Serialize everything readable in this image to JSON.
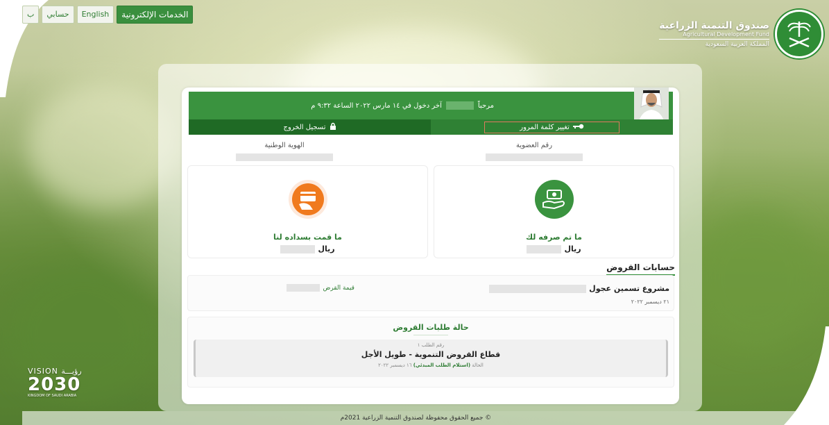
{
  "topnav": {
    "eservices": "الخدمات الإلكترونية",
    "english": "English",
    "account": "حسابي",
    "extra": "ب"
  },
  "logo": {
    "ar_name": "صندوق التنمية الزراعية",
    "en_name": "Agricultural Development Fund",
    "kingdom": "المملكة العربية السعودية"
  },
  "vision": {
    "line1": "VISION رؤيـــة",
    "line2": "2030",
    "line3": "KINGDOM OF SAUDI ARABIA"
  },
  "welcome": {
    "greeting": "مرحباً",
    "last_login": "آخر دخول في ١٤ مارس ٢٠٢٢ الساعة ٩:٣٢ م"
  },
  "actions": {
    "change_password": "تغيير كلمة المرور",
    "logout": "تسجيل الخروج"
  },
  "ids": {
    "membership_label": "رقم العضوية",
    "national_id_label": "الهوية الوطنية"
  },
  "summary": {
    "disbursed_label": "ما تم صرفه لك",
    "disbursed_currency": "ريال",
    "repaid_label": "ما قمت بسداده لنا",
    "repaid_currency": "ريال"
  },
  "loans": {
    "title": "حسابات القروض",
    "project": "مشروع تسمين عجول",
    "date": "٢١ ديسمبر ٢٠٢٢",
    "value_label": "قيمة القرض"
  },
  "status": {
    "title": "حالة طلبات القروض",
    "request_no": "رقم الطلب ١",
    "sector": "قطاع القروض التنموية - طويل الأجل",
    "state_label": "الحالة",
    "state_value": "(استلام الطلب المبدئي)",
    "state_date": "١٦ ديسمبر ٢٠٢٢"
  },
  "footer": {
    "text": "© جميع الحقوق محفوظة لصندوق التنمية الزراعية 2021م"
  },
  "colors": {
    "brand": "#3a933f",
    "dark": "#1f6a25",
    "orange": "#f07a1e"
  }
}
